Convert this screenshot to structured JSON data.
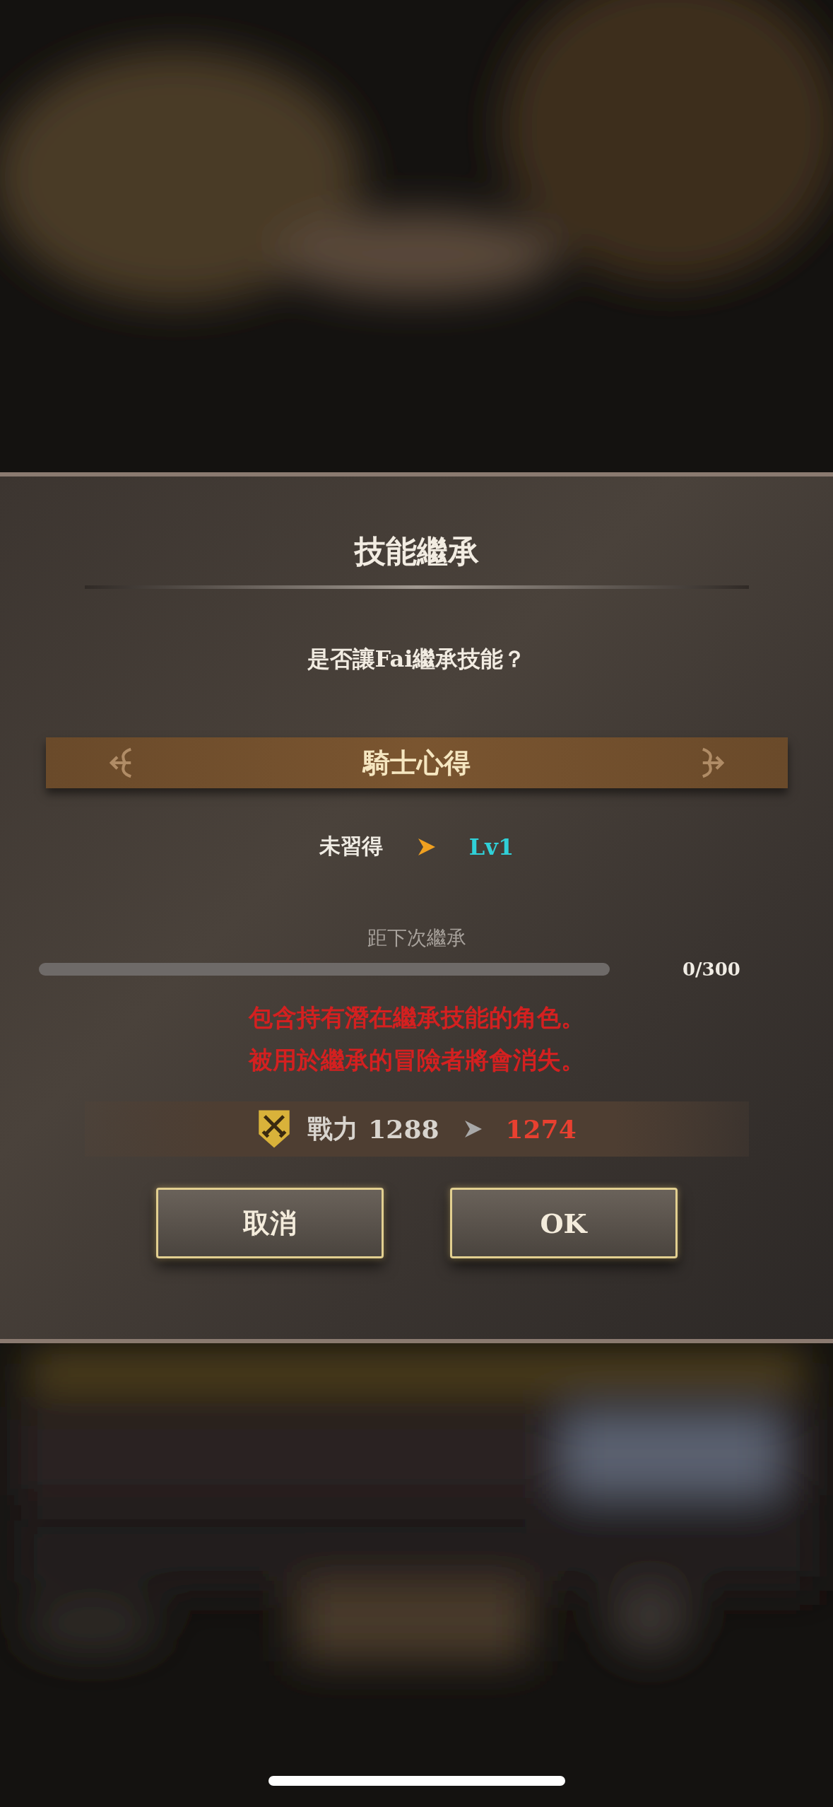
{
  "dialog": {
    "title": "技能繼承",
    "question": "是否讓Fai繼承技能？",
    "skill": {
      "name": "騎士心得"
    },
    "level_change": {
      "from": "未習得",
      "to": "Lv1"
    },
    "progress": {
      "label": "距下次繼承",
      "level": 0,
      "reading": "0/300"
    },
    "warnings": [
      "包含持有潛在繼承技能的角色。",
      "被用於繼承的冒險者將會消失。"
    ],
    "power": {
      "label": "戰力",
      "from": "1288",
      "to": "1274"
    },
    "buttons": [
      "取消",
      "OK"
    ]
  }
}
